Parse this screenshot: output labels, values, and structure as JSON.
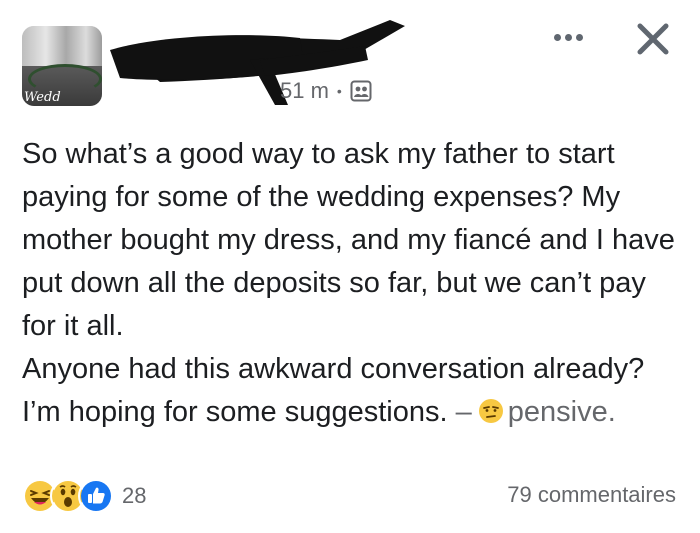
{
  "post": {
    "avatar_label": "Wedd",
    "time": "51 m",
    "separator": "•",
    "privacy_icon": "group-privacy-icon",
    "body": [
      "So what’s a good way to ask my father to start paying for some of the wedding expenses? My mother bought my dress, and my fiancé and I have put down all the deposits so far, but we can’t pay for it all.",
      "Anyone had this awkward conversation already? I’m hoping for some suggestions."
    ],
    "feeling_dash": "–",
    "feeling_icon": "pensive-emoji",
    "feeling_label": "pensive."
  },
  "actions": {
    "more_icon": "more-dots-icon",
    "close_icon": "close-icon"
  },
  "footer": {
    "reactions": [
      "haha",
      "wow",
      "like"
    ],
    "reaction_count": "28",
    "comments_label": "79 commentaires"
  },
  "colors": {
    "text": "#1c1e21",
    "secondary": "#65676b",
    "like_blue": "#1877f2",
    "emoji_yellow": "#f7c842"
  }
}
